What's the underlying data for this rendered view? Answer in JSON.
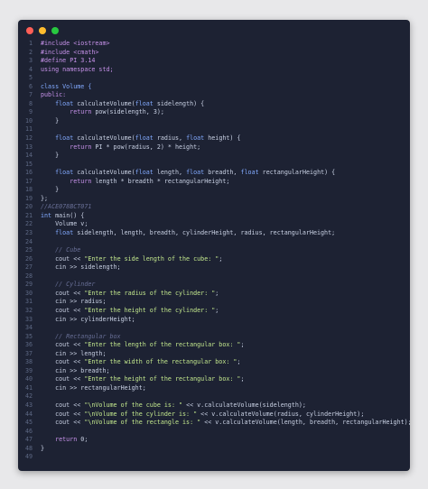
{
  "window": {
    "buttons": [
      "close",
      "minimize",
      "maximize"
    ]
  },
  "code": {
    "lines": [
      [
        {
          "t": "#include <iostream>",
          "c": "p"
        }
      ],
      [
        {
          "t": "#include <cmath>",
          "c": "p"
        }
      ],
      [
        {
          "t": "#define PI 3.14",
          "c": "p"
        }
      ],
      [
        {
          "t": "using namespace std;",
          "c": "k"
        }
      ],
      [],
      [
        {
          "t": "class Volume {",
          "c": "t"
        }
      ],
      [
        {
          "t": "public:",
          "c": "k"
        }
      ],
      [
        {
          "t": "    float ",
          "c": "t"
        },
        {
          "t": "calculateVolume(",
          "c": ""
        },
        {
          "t": "float ",
          "c": "t"
        },
        {
          "t": "sidelength) {",
          "c": ""
        }
      ],
      [
        {
          "t": "        return ",
          "c": "k"
        },
        {
          "t": "pow(sidelength, 3);",
          "c": ""
        }
      ],
      [
        {
          "t": "    }",
          "c": ""
        }
      ],
      [],
      [
        {
          "t": "    float ",
          "c": "t"
        },
        {
          "t": "calculateVolume(",
          "c": ""
        },
        {
          "t": "float ",
          "c": "t"
        },
        {
          "t": "radius, ",
          "c": ""
        },
        {
          "t": "float ",
          "c": "t"
        },
        {
          "t": "height) {",
          "c": ""
        }
      ],
      [
        {
          "t": "        return ",
          "c": "k"
        },
        {
          "t": "PI * pow(radius, 2) * height;",
          "c": ""
        }
      ],
      [
        {
          "t": "    }",
          "c": ""
        }
      ],
      [],
      [
        {
          "t": "    float ",
          "c": "t"
        },
        {
          "t": "calculateVolume(",
          "c": ""
        },
        {
          "t": "float ",
          "c": "t"
        },
        {
          "t": "length, ",
          "c": ""
        },
        {
          "t": "float ",
          "c": "t"
        },
        {
          "t": "breadth, ",
          "c": ""
        },
        {
          "t": "float ",
          "c": "t"
        },
        {
          "t": "rectangularHeight) {",
          "c": ""
        }
      ],
      [
        {
          "t": "        return ",
          "c": "k"
        },
        {
          "t": "length * breadth * rectangularHeight;",
          "c": ""
        }
      ],
      [
        {
          "t": "    }",
          "c": ""
        }
      ],
      [
        {
          "t": "};",
          "c": ""
        }
      ],
      [
        {
          "t": "//ACE078BCT071",
          "c": "c"
        }
      ],
      [
        {
          "t": "int ",
          "c": "t"
        },
        {
          "t": "main() {",
          "c": ""
        }
      ],
      [
        {
          "t": "    Volume v;",
          "c": ""
        }
      ],
      [
        {
          "t": "    float ",
          "c": "t"
        },
        {
          "t": "sidelength, length, breadth, cylinderHeight, radius, rectangularHeight;",
          "c": ""
        }
      ],
      [],
      [
        {
          "t": "    // Cube",
          "c": "c"
        }
      ],
      [
        {
          "t": "    cout << ",
          "c": ""
        },
        {
          "t": "\"Enter the side length of the cube: \"",
          "c": "s"
        },
        {
          "t": ";",
          "c": ""
        }
      ],
      [
        {
          "t": "    cin >> sidelength;",
          "c": ""
        }
      ],
      [],
      [
        {
          "t": "    // Cylinder",
          "c": "c"
        }
      ],
      [
        {
          "t": "    cout << ",
          "c": ""
        },
        {
          "t": "\"Enter the radius of the cylinder: \"",
          "c": "s"
        },
        {
          "t": ";",
          "c": ""
        }
      ],
      [
        {
          "t": "    cin >> radius;",
          "c": ""
        }
      ],
      [
        {
          "t": "    cout << ",
          "c": ""
        },
        {
          "t": "\"Enter the height of the cylinder: \"",
          "c": "s"
        },
        {
          "t": ";",
          "c": ""
        }
      ],
      [
        {
          "t": "    cin >> cylinderHeight;",
          "c": ""
        }
      ],
      [],
      [
        {
          "t": "    // Rectangular box",
          "c": "c"
        }
      ],
      [
        {
          "t": "    cout << ",
          "c": ""
        },
        {
          "t": "\"Enter the length of the rectangular box: \"",
          "c": "s"
        },
        {
          "t": ";",
          "c": ""
        }
      ],
      [
        {
          "t": "    cin >> length;",
          "c": ""
        }
      ],
      [
        {
          "t": "    cout << ",
          "c": ""
        },
        {
          "t": "\"Enter the width of the rectangular box: \"",
          "c": "s"
        },
        {
          "t": ";",
          "c": ""
        }
      ],
      [
        {
          "t": "    cin >> breadth;",
          "c": ""
        }
      ],
      [
        {
          "t": "    cout << ",
          "c": ""
        },
        {
          "t": "\"Enter the height of the rectangular box: \"",
          "c": "s"
        },
        {
          "t": ";",
          "c": ""
        }
      ],
      [
        {
          "t": "    cin >> rectangularHeight;",
          "c": ""
        }
      ],
      [],
      [
        {
          "t": "    cout << ",
          "c": ""
        },
        {
          "t": "\"\\nVolume of the cube is: \"",
          "c": "s"
        },
        {
          "t": " << v.calculateVolume(sidelength);",
          "c": ""
        }
      ],
      [
        {
          "t": "    cout << ",
          "c": ""
        },
        {
          "t": "\"\\nVolume of the cylinder is: \"",
          "c": "s"
        },
        {
          "t": " << v.calculateVolume(radius, cylinderHeight);",
          "c": ""
        }
      ],
      [
        {
          "t": "    cout << ",
          "c": ""
        },
        {
          "t": "\"\\nVolume of the rectangle is: \"",
          "c": "s"
        },
        {
          "t": " << v.calculateVolume(length, breadth, rectangularHeight);",
          "c": ""
        }
      ],
      [],
      [
        {
          "t": "    return ",
          "c": "k"
        },
        {
          "t": "0;",
          "c": ""
        }
      ],
      [
        {
          "t": "}",
          "c": ""
        }
      ],
      []
    ]
  }
}
